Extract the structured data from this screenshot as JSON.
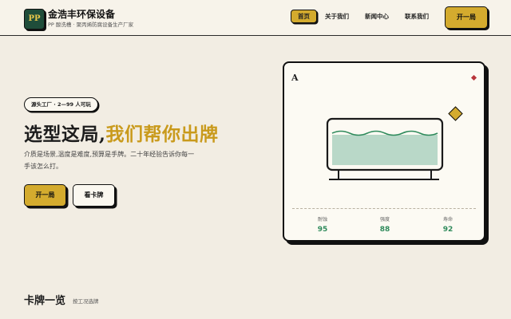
{
  "brand": {
    "logo": "PP",
    "name": "金浩丰环保设备",
    "tagline": "PP 酸洗槽 · 聚丙烯防腐设备生产厂家"
  },
  "nav": {
    "items": [
      "首页",
      "关于我们",
      "新闻中心",
      "联系我们"
    ],
    "active": "首页"
  },
  "header": {
    "cta_label": "开一局"
  },
  "hero": {
    "badge": "源头工厂 · 2—99 人可玩",
    "title_plain": "选型这局,",
    "title_highlight": "我们帮你出牌",
    "description": "介质是场景,温度是难度,预算是手牌。二十年经验告诉你每一手该怎么打。",
    "primary_label": "开一局",
    "secondary_label": "看卡牌"
  },
  "card": {
    "corner": "A",
    "stats": [
      {
        "label": "耐蚀",
        "value": "95"
      },
      {
        "label": "强度",
        "value": "88"
      },
      {
        "label": "寿命",
        "value": "92"
      }
    ]
  },
  "section": {
    "title": "卡牌一览",
    "subtitle": "按工况选牌"
  },
  "colors": {
    "accent": "#d4ab2e",
    "brand": "#1f4d3a",
    "stat": "#2e8a5b",
    "pip": "#b8343a",
    "background": "#f2ede3"
  },
  "icons": {
    "logo": "pp-logo-icon",
    "suit": "diamond-icon",
    "tank": "tank-illustration-icon"
  }
}
